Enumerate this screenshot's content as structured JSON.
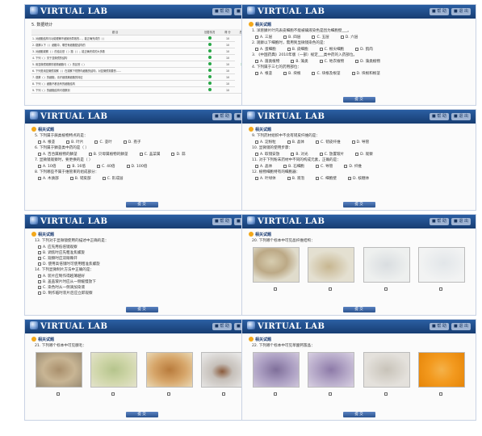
{
  "brand": {
    "name": "VIRTUAL LAB"
  },
  "header_buttons": [
    "■ 帮 助",
    "■ 退 出"
  ],
  "submit_label": "提 交",
  "section_title": "相关试题",
  "p1": {
    "title": "5. 数据统计",
    "columns": [
      "题 目",
      "回答情况",
      "得 分",
      "总得分"
    ],
    "rows": [
      {
        "text": "1. 对细胞结构与功能理解不细致而导致的…，能正确完成的（ ）",
        "score": "10"
      },
      {
        "text": "2. 观察以下（ ）细胞中，哪些有细胞壁结构的",
        "score": "10"
      },
      {
        "text": "3. 对细胞观察（ ）的结论是（ ）题（ ）；能正确完成的大多数",
        "score": "10"
      },
      {
        "text": "4. 下列（ ）关于显微镜的结构",
        "score": "10"
      },
      {
        "text": "5. 用显微镜观察的植物细胞与（ ）的区别（ ）",
        "score": "10"
      },
      {
        "text": "6. 下列是用显微镜观察（ ）在观察下视野内细胞的结构，对显微镜需要的……",
        "score": "10"
      },
      {
        "text": "7. 观察（ ）的细胞，请仔细观察细胞的特征",
        "score": "10"
      },
      {
        "text": "8. 下列（ ）细胞不都含有的细胞结构",
        "score": "10"
      },
      {
        "text": "9. 下列（ ）的细胞结构可观察到",
        "score": "10"
      }
    ],
    "total": "100"
  },
  "p2": {
    "qs": [
      {
        "q": "1. 洋葱鳞片叶内表皮细胞不能被碘液染色是因为细胞壁___。",
        "opts": [
          "A. 三层",
          "B. 四层",
          "C. 五层",
          "D. 六层"
        ]
      },
      {
        "q": "2. 观察以下细胞时，需用到显微镜染色的是：",
        "opts": [
          "A. 蛋细胞",
          "B. 皮细胞",
          "C. 根尖细胞",
          "D. 肌肉"
        ]
      },
      {
        "q": "3. 《中国药典》2010年版（一部）规定___类中药的入药部位。",
        "opts": [
          "A. 菌类植物",
          "B. 藻类",
          "C. 地衣植物",
          "D. 藻类植物"
        ]
      },
      {
        "q": "4. 下列属于三七的药用部位：",
        "opts": [
          "A. 根茎",
          "B. 块根",
          "C. 块根及根茎",
          "D. 块根和根茎"
        ]
      }
    ]
  },
  "p3": {
    "qs": [
      {
        "q": "5. 下列属于蕨类植物特点的是：",
        "opts": [
          "A. 根茎",
          "B. 叶片",
          "C. 茎叶",
          "D. 孢子"
        ]
      },
      {
        "q": "6. 下列属于鳞茎类中药的是（ ）",
        "opts": [
          "A. 百合属植物的鳞茎",
          "B. 贝母属植物的鳞茎",
          "C. 韭菜属",
          "D. 蒜"
        ]
      },
      {
        "q": "7. 显微镜观察时，要更换的是（ ）",
        "opts": [
          "A. 10倍",
          "B. 16倍",
          "C. 40倍",
          "D. 100倍"
        ]
      },
      {
        "q": "8. 下列哪些不属于维管束的组成部分：",
        "opts": [
          "A. 木质部",
          "B. 韧皮部",
          "C. 形成层"
        ]
      }
    ]
  },
  "p4": {
    "qs": [
      {
        "q": "9. 下列药材组织中不含有韧皮纤维的是：",
        "opts": [
          "A. 淀粉粒",
          "B. 晶体",
          "C. 韧皮纤维",
          "D. 导管"
        ]
      },
      {
        "q": "10. 显微镜的使用步骤：",
        "opts": [
          "A. 取镜安放",
          "B. 对光",
          "C. 放置玻片",
          "D. 观察"
        ]
      },
      {
        "q": "11. 对于下列粉末药材中不同的构成元素，正确的是：",
        "opts": [
          "A. 晶体",
          "B. 石细胞",
          "C. 导管",
          "D. 纤维"
        ]
      },
      {
        "q": "12. 植物细胞特有的细胞器：",
        "opts": [
          "A. 叶绿体",
          "B. 液泡",
          "C. 细胞壁",
          "D. 核糖体"
        ]
      }
    ]
  },
  "p5": {
    "q1": "13. 下列对于显微镜使用的描述中正确的是：",
    "q1opts": [
      "A. 应先用低倍镜观察",
      "B. 调焦时应先粗准焦螺旋",
      "C. 观察时应双眼睁开",
      "D. 使用高倍镜时可使用粗准焦螺旋"
    ],
    "q2": "14. 下列显微制片方法中正确的是：",
    "q2opts": [
      "A. 装片应制作得越薄越好",
      "B. 盖盖玻片时应从一侧缓慢放下",
      "C. 染色时从一侧滴加染液",
      "D. 制作临时装片后应立即观察"
    ]
  },
  "p6": {
    "q": "20. 下列哪个标本中可见晶纤维结构："
  },
  "p7": {
    "q": "21. 下列哪个标本中可见腺毛："
  },
  "p8": {
    "q": "22. 下列哪个标本中可见草酸钙簇晶："
  }
}
